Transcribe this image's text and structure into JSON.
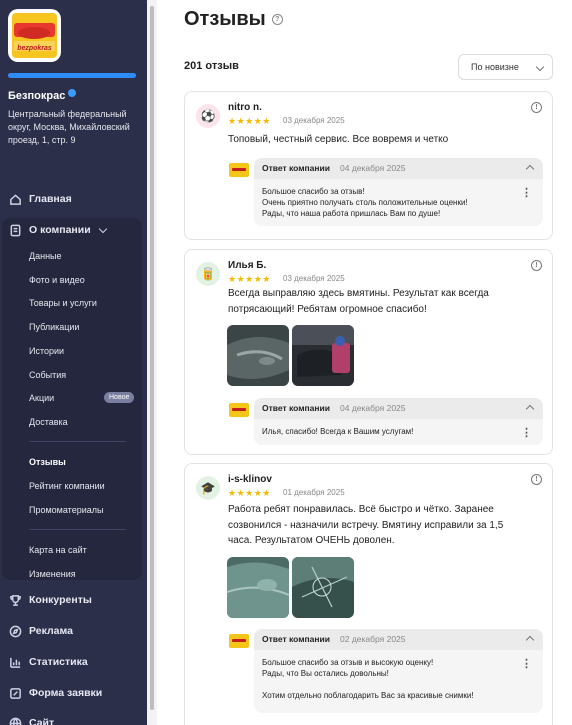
{
  "sidebar": {
    "company_name": "Безпокрас",
    "address": "Центральный федеральный округ, Москва, Михайловский проезд, 1, стр. 9",
    "logo_text": "bezpokras",
    "progress": 1.0,
    "nav": {
      "home": "Главная",
      "about": "О компании",
      "competitors": "Конкуренты",
      "ads": "Реклама",
      "stats": "Статистика",
      "form": "Форма заявки",
      "site": "Сайт"
    },
    "sub": {
      "data": "Данные",
      "photo": "Фото и видео",
      "goods": "Товары и услуги",
      "posts": "Публикации",
      "stories": "Истории",
      "events": "События",
      "promo": "Акции",
      "delivery": "Доставка",
      "reviews": "Отзывы",
      "rating": "Рейтинг компании",
      "materials": "Промоматериалы",
      "map": "Карта на сайт",
      "changes": "Изменения"
    },
    "promo_badge": "Новое"
  },
  "main": {
    "title": "Отзывы",
    "count": "201 отзыв",
    "sort_label": "По новизне"
  },
  "reviews": [
    {
      "author": "nitro n.",
      "stars": "★★★★★",
      "date": "03 декабря 2025",
      "text": "Топовый, честный сервис. Все вовремя и четко",
      "reply_label": "Ответ компании",
      "reply_date": "04 декабря 2025",
      "reply_lines": [
        "Большое спасибо за отзыв!",
        "Очень приятно получать столь положительные оценки!",
        "Рады, что наша работа пришлась Вам по душе!"
      ]
    },
    {
      "author": "Илья Б.",
      "stars": "★★★★★",
      "date": "03 декабря 2025",
      "text": "Всегда выправляю здесь вмятины. Результат как всегда потрясающий! Ребятам огромное спасибо!",
      "reply_label": "Ответ компании",
      "reply_date": "04 декабря 2025",
      "reply_lines": [
        "Илья, спасибо! Всегда к Вашим услугам!"
      ]
    },
    {
      "author": "i-s-klinov",
      "stars": "★★★★★",
      "date": "01 декабря 2025",
      "text": "Работа ребят понравилась. Всё быстро и чётко. Заранее созвонился - назначили встречу. Вмятину исправили за 1,5 часа. Результатом ОЧЕНЬ доволен.",
      "reply_label": "Ответ компании",
      "reply_date": "02 декабря 2025",
      "reply_lines": [
        "Большое спасибо за отзыв и высокую оценку!",
        "Рады, что Вы остались довольны!",
        "",
        "Хотим отдельно поблагодарить Вас за красивые снимки!"
      ]
    }
  ],
  "colors": {
    "sidebar_bg": "#2b2f4a",
    "accent": "#2f8cff",
    "star": "#f5b900"
  }
}
